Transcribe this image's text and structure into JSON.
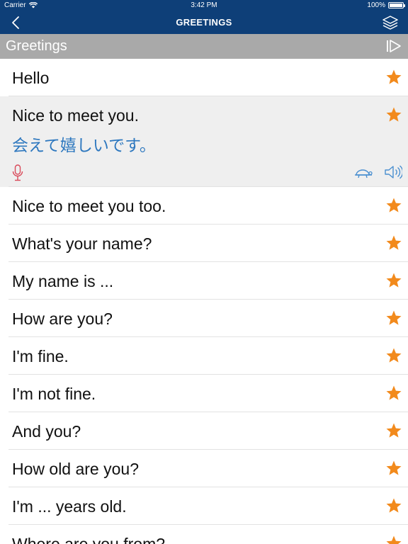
{
  "status_bar": {
    "carrier": "Carrier",
    "time": "3:42 PM",
    "battery": "100%"
  },
  "nav": {
    "title": "GREETINGS",
    "back_icon": "chevron-left-icon",
    "layers_icon": "layers-icon"
  },
  "section": {
    "title": "Greetings",
    "play_icon": "play-all-icon"
  },
  "phrases": [
    {
      "text": "Hello"
    },
    {
      "text": "Nice to meet you.",
      "translation": "会えて嬉しいです。"
    },
    {
      "text": "Nice to meet you too."
    },
    {
      "text": "What's your name?"
    },
    {
      "text": "My name is ..."
    },
    {
      "text": "How are you?"
    },
    {
      "text": "I'm fine."
    },
    {
      "text": "I'm not fine."
    },
    {
      "text": "And you?"
    },
    {
      "text": "How old are you?"
    },
    {
      "text": "I'm ... years old."
    },
    {
      "text": "Where are you from?"
    }
  ],
  "colors": {
    "nav_bg": "#0e3f78",
    "section_bg": "#a9a9a9",
    "star": "#f28a1c",
    "translation": "#2e78bf",
    "mic": "#d94a5a",
    "action_icons": "#4a8fd0",
    "expanded_bg": "#efefef"
  }
}
